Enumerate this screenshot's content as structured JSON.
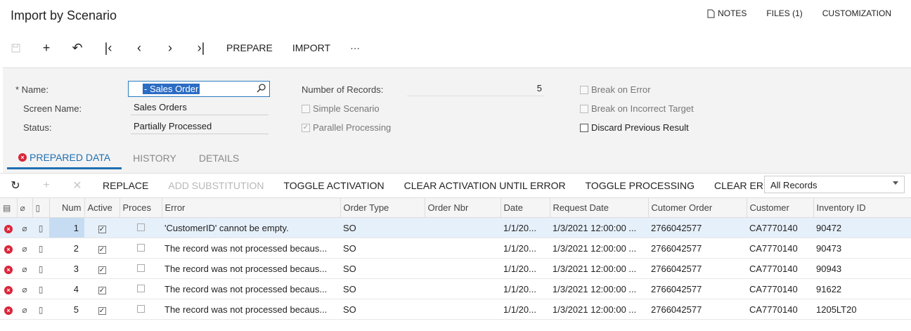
{
  "header": {
    "title": "Import by Scenario",
    "links": {
      "notes": "NOTES",
      "files": "FILES (1)",
      "customization": "CUSTOMIZATION"
    }
  },
  "toolbar": {
    "prepare": "PREPARE",
    "import": "IMPORT",
    "more": "···"
  },
  "form": {
    "name_label": "Name:",
    "name_value_selected": "- Sales Order",
    "screen_name_label": "Screen Name:",
    "screen_name_value": "Sales Orders",
    "status_label": "Status:",
    "status_value": "Partially Processed",
    "records_label": "Number of Records:",
    "records_value": "5",
    "simple_scenario": "Simple Scenario",
    "parallel_processing": "Parallel Processing",
    "break_on_error": "Break on Error",
    "break_on_incorrect_target": "Break on Incorrect Target",
    "discard_previous_result": "Discard Previous Result"
  },
  "tabs": {
    "prepared": "PREPARED DATA",
    "history": "HISTORY",
    "details": "DETAILS"
  },
  "grid_toolbar": {
    "replace": "REPLACE",
    "add_substitution": "ADD SUBSTITUTION",
    "toggle_activation": "TOGGLE ACTIVATION",
    "clear_activation": "CLEAR ACTIVATION UNTIL ERROR",
    "toggle_processing": "TOGGLE PROCESSING",
    "clear_errors": "CLEAR ERRORS",
    "filter_value": "All Records"
  },
  "columns": {
    "num": "Num",
    "active": "Active",
    "processed": "Proces",
    "error": "Error",
    "order_type": "Order Type",
    "order_nbr": "Order Nbr",
    "date": "Date",
    "request_date": "Request Date",
    "customer_order": "Cutomer Order",
    "customer": "Customer",
    "inventory_id": "Inventory ID"
  },
  "rows": [
    {
      "num": "1",
      "error": "'CustomerID' cannot be empty.",
      "order_type": "SO",
      "order_nbr": "",
      "date": "1/1/20...",
      "request_date": "1/3/2021 12:00:00 ...",
      "customer_order": "2766042577",
      "customer": "CA7770140",
      "inventory_id": "90472"
    },
    {
      "num": "2",
      "error": "The record was not processed becaus...",
      "order_type": "SO",
      "order_nbr": "",
      "date": "1/1/20...",
      "request_date": "1/3/2021 12:00:00 ...",
      "customer_order": "2766042577",
      "customer": "CA7770140",
      "inventory_id": "90473"
    },
    {
      "num": "3",
      "error": "The record was not processed becaus...",
      "order_type": "SO",
      "order_nbr": "",
      "date": "1/1/20...",
      "request_date": "1/3/2021 12:00:00 ...",
      "customer_order": "2766042577",
      "customer": "CA7770140",
      "inventory_id": "90943"
    },
    {
      "num": "4",
      "error": "The record was not processed becaus...",
      "order_type": "SO",
      "order_nbr": "",
      "date": "1/1/20...",
      "request_date": "1/3/2021 12:00:00 ...",
      "customer_order": "2766042577",
      "customer": "CA7770140",
      "inventory_id": "91622"
    },
    {
      "num": "5",
      "error": "The record was not processed becaus...",
      "order_type": "SO",
      "order_nbr": "",
      "date": "1/1/20...",
      "request_date": "1/3/2021 12:00:00 ...",
      "customer_order": "2766042577",
      "customer": "CA7770140",
      "inventory_id": "1205LT20"
    }
  ]
}
